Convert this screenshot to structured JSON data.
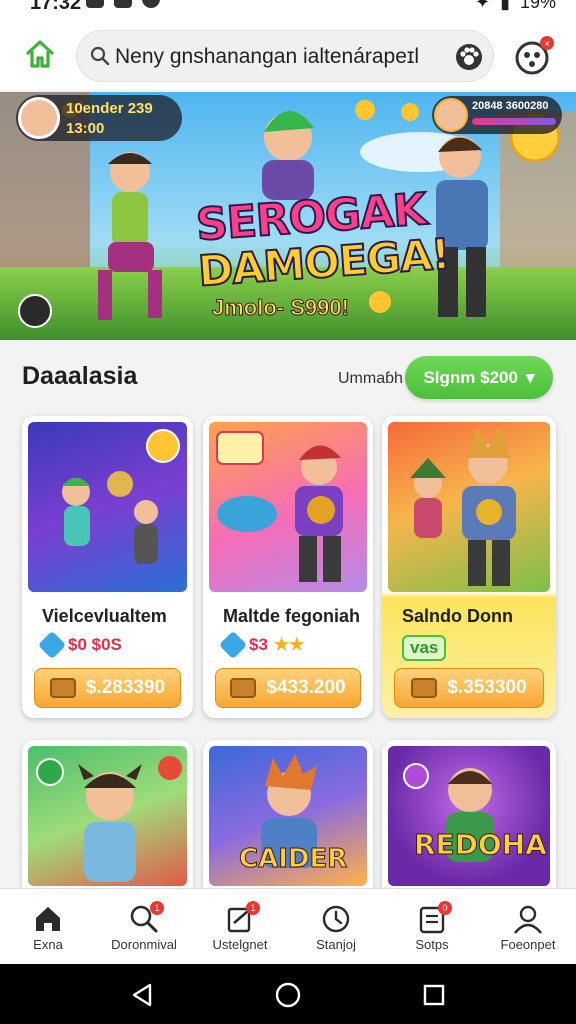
{
  "status": {
    "time": "17:32",
    "battery": "19%"
  },
  "search": {
    "value": "Neny gnshanangan ialtenárapeɪl"
  },
  "banner": {
    "left_badge": {
      "line1": "10ender 239",
      "line2": "13:00"
    },
    "right_badge": {
      "line1": "20848 3600280"
    },
    "headline_line1": "SEROGAK",
    "headline_line2": "DAMOEGA!",
    "price_tag": "Jmolo- S990!"
  },
  "section": {
    "title": "Daaalasia",
    "link": "Ummaɓh",
    "filter_label": "Slgnm $200"
  },
  "cards": [
    {
      "title": "Vielcevlualtem",
      "price": "$0 $0S",
      "buy": "$.283390"
    },
    {
      "title": "Maltde fegoniah",
      "price": "$3",
      "buy": "$433.200"
    },
    {
      "title": "Salndo Donn",
      "price": "vas",
      "buy": "$.353300"
    }
  ],
  "cards_row2": [
    {
      "art_label": ""
    },
    {
      "art_label": "CAIDER"
    },
    {
      "art_label": "REDOHA"
    }
  ],
  "nav": [
    {
      "label": "Exna",
      "badge": ""
    },
    {
      "label": "Doronmival",
      "badge": "1"
    },
    {
      "label": "Ustelgnet",
      "badge": "1"
    },
    {
      "label": "Stanjoj",
      "badge": ""
    },
    {
      "label": "Sotps",
      "badge": "0"
    },
    {
      "label": "Foeonpet",
      "badge": ""
    }
  ],
  "colors": {
    "accent": "#4cbf3a",
    "buy": "#f8a531",
    "badge": "#e53935"
  }
}
